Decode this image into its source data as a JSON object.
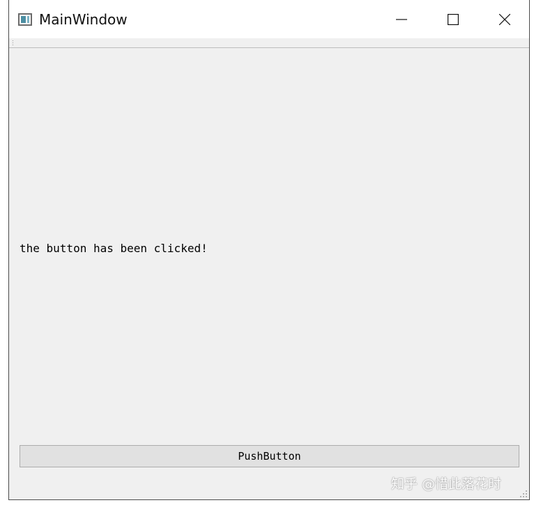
{
  "window": {
    "title": "MainWindow",
    "icon": "app-window-icon",
    "controls": {
      "minimize": "minimize-icon",
      "maximize": "maximize-icon",
      "close": "close-icon"
    }
  },
  "central": {
    "label_text": "the button has been clicked!",
    "push_button_label": "PushButton"
  },
  "watermark": {
    "text": "知乎 @惜此落花时"
  },
  "colors": {
    "window_bg": "#f0f0f0",
    "titlebar_bg": "#ffffff",
    "button_bg": "#e1e1e1",
    "button_border": "#adadad"
  }
}
